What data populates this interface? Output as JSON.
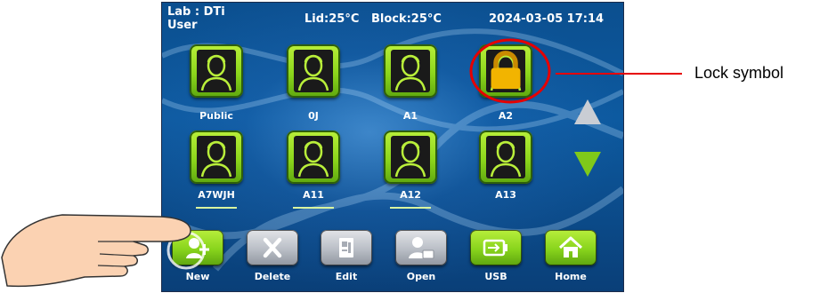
{
  "header": {
    "lab": "Lab : DTi",
    "user_label": "User",
    "temperatures": "Lid:25°C   Block:25°C",
    "datetime": "2024-03-05 17:14"
  },
  "users": [
    {
      "name": "Public",
      "locked": false
    },
    {
      "name": "0J",
      "locked": false
    },
    {
      "name": "A1",
      "locked": false
    },
    {
      "name": "A2",
      "locked": true
    },
    {
      "name": "A7WJH",
      "locked": false
    },
    {
      "name": "A11",
      "locked": false
    },
    {
      "name": "A12",
      "locked": false
    },
    {
      "name": "A13",
      "locked": false
    }
  ],
  "toolbar": {
    "new_label": "New",
    "delete_label": "Delete",
    "edit_label": "Edit",
    "open_label": "Open",
    "usb_label": "USB",
    "home_label": "Home"
  },
  "annotation": {
    "callout_text": "Lock symbol",
    "callout_color": "#e60000"
  },
  "colors": {
    "tile_green": "#8cd61b",
    "screen_blue": "#0d5aa0"
  }
}
